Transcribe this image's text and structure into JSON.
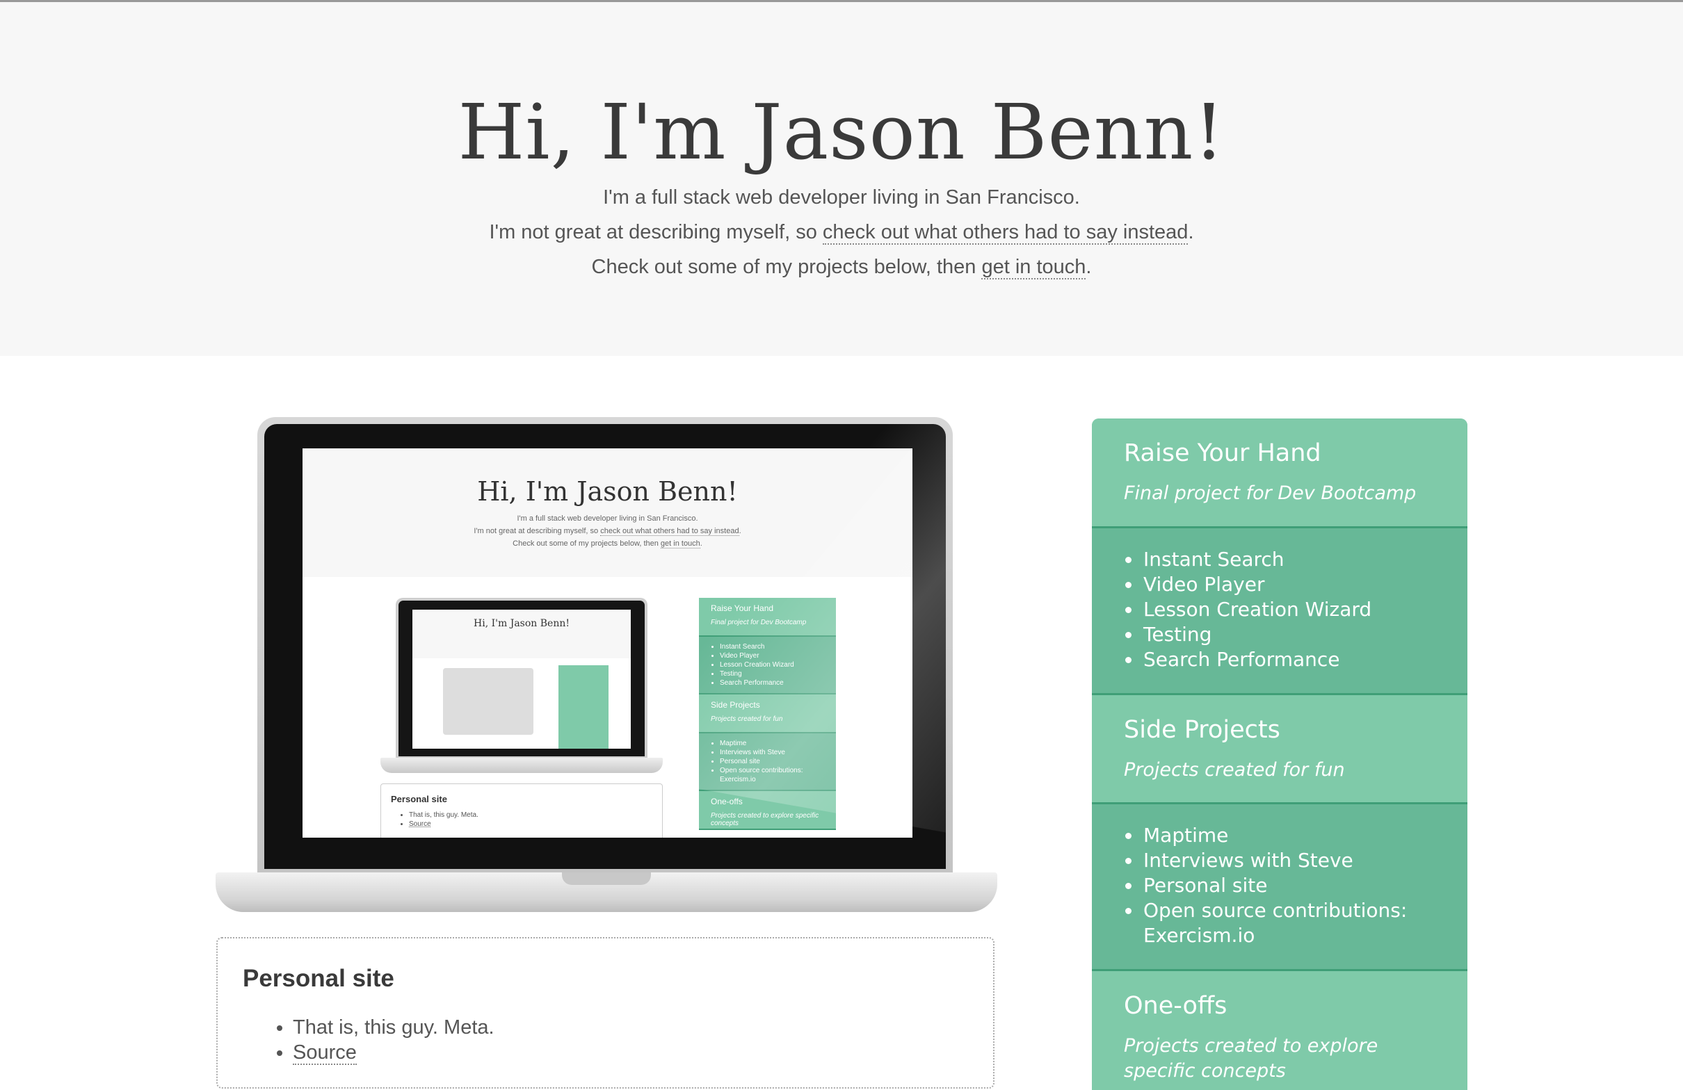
{
  "hero": {
    "title": "Hi, I'm Jason Benn!",
    "line1": "I'm a full stack web developer living in San Francisco.",
    "line2_prefix": "I'm not great at describing myself, so ",
    "line2_link": "check out what others had to say instead",
    "line2_suffix": ".",
    "line3_prefix": "Check out some of my projects below, then ",
    "line3_link": "get in touch",
    "line3_suffix": "."
  },
  "mini": {
    "title": "Hi, I'm Jason Benn!",
    "line1": "I'm a full stack web developer living in San Francisco.",
    "line2_prefix": "I'm not great at describing myself, so ",
    "line2_link": "check out what others had to say instead",
    "line2_suffix": ".",
    "line3_prefix": "Check out some of my projects below, then ",
    "line3_link": "get in touch",
    "line3_suffix": ".",
    "nested_title": "Hi, I'm Jason Benn!",
    "card_title": "Personal site",
    "card_items": [
      "That is, this guy. Meta.",
      "Source"
    ],
    "side": [
      {
        "title": "Raise Your Hand",
        "sub": "Final project for Dev Bootcamp",
        "items": [
          "Instant Search",
          "Video Player",
          "Lesson Creation Wizard",
          "Testing",
          "Search Performance"
        ]
      },
      {
        "title": "Side Projects",
        "sub": "Projects created for fun",
        "items": [
          "Maptime",
          "Interviews with Steve",
          "Personal site",
          "Open source contributions:",
          "Exercism.io"
        ]
      },
      {
        "title": "One-offs",
        "sub": "Projects created to explore specific concepts"
      }
    ]
  },
  "card": {
    "title": "Personal site",
    "item1": "That is, this guy. Meta.",
    "item2": "Source"
  },
  "sidebar": {
    "sections": [
      {
        "title": "Raise Your Hand",
        "subtitle": "Final project for Dev Bootcamp",
        "items": [
          "Instant Search",
          "Video Player",
          "Lesson Creation Wizard",
          "Testing",
          "Search Performance"
        ]
      },
      {
        "title": "Side Projects",
        "subtitle": "Projects created for fun",
        "items": [
          "Maptime",
          "Interviews with Steve",
          "Personal site",
          "Open source contributions:",
          "Exercism.io"
        ]
      },
      {
        "title": "One-offs",
        "subtitle": "Projects created to explore specific concepts"
      }
    ]
  },
  "colors": {
    "accent": "#7fcaa9",
    "accent_dark": "#67b897",
    "divider": "#3f9e77",
    "hero_bg": "#f7f7f7"
  }
}
